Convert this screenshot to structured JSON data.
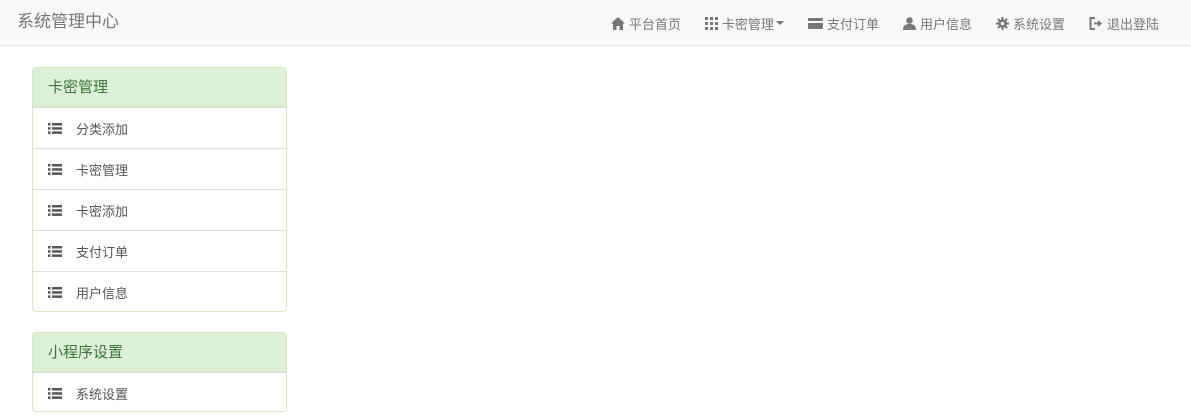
{
  "navbar": {
    "brand": "系统管理中心",
    "items": [
      {
        "label": "平台首页",
        "icon": "home-icon"
      },
      {
        "label": "卡密管理",
        "icon": "grid-icon",
        "dropdown": true
      },
      {
        "label": "支付订单",
        "icon": "credit-card-icon"
      },
      {
        "label": "用户信息",
        "icon": "user-icon"
      },
      {
        "label": "系统设置",
        "icon": "gear-icon"
      },
      {
        "label": "退出登陆",
        "icon": "logout-icon"
      }
    ]
  },
  "sidebar": {
    "panels": [
      {
        "title": "卡密管理",
        "items": [
          {
            "label": "分类添加",
            "icon": "list-icon"
          },
          {
            "label": "卡密管理",
            "icon": "list-icon"
          },
          {
            "label": "卡密添加",
            "icon": "list-icon"
          },
          {
            "label": "支付订单",
            "icon": "list-icon"
          },
          {
            "label": "用户信息",
            "icon": "list-icon"
          }
        ]
      },
      {
        "title": "小程序设置",
        "items": [
          {
            "label": "系统设置",
            "icon": "list-icon"
          }
        ]
      }
    ]
  },
  "colors": {
    "navbar_bg": "#f8f8f8",
    "panel_heading_bg": "#dff0d8",
    "panel_heading_text": "#3c763d",
    "panel_border": "#d6e9c6"
  }
}
